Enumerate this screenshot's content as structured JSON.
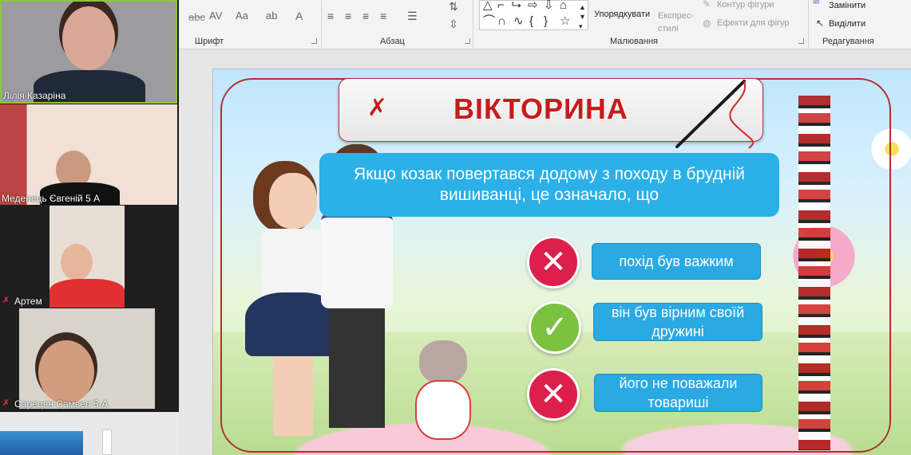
{
  "ribbon": {
    "groups": [
      {
        "id": "font",
        "label": "Шрифт"
      },
      {
        "id": "paragraph",
        "label": "Абзац"
      },
      {
        "id": "drawing",
        "label": "Малювання"
      },
      {
        "id": "editing",
        "label": "Редагування"
      }
    ],
    "arrange_label": "Упорядкувати",
    "quick_styles_label": "Експрес-стилі",
    "shape_outline_label": "Контур фігури",
    "shape_effects_label": "Ефекти для фігур",
    "replace_label": "Замінити",
    "select_label": "Виділити",
    "font_size_glyphs": "Aa",
    "spacing_glyph": "AV"
  },
  "participants": [
    {
      "name": "Лілія Казаріна",
      "muted": false,
      "active": true
    },
    {
      "name": "Меденець Євгеній 5 А",
      "muted": false,
      "active": false
    },
    {
      "name": "Артем",
      "muted": true,
      "active": false
    },
    {
      "name": "Сарецян Самвел 5-А",
      "muted": true,
      "active": false
    }
  ],
  "slide": {
    "title": "ВІКТОРИНА",
    "question": "Якщо козак повертався додому з походу в брудній вишиванці, це означало, що",
    "answers": [
      {
        "text": "похід був важким",
        "correct": false
      },
      {
        "text": "він був вірним своїй дружині",
        "correct": true
      },
      {
        "text": "його не поважали товариші",
        "correct": false
      }
    ]
  },
  "colors": {
    "title_red": "#c71c1c",
    "question_blue": "#2bb0e8",
    "wrong_red": "#dc1f4d",
    "correct_green": "#7bc241",
    "active_speaker_border": "#8dc63f"
  }
}
